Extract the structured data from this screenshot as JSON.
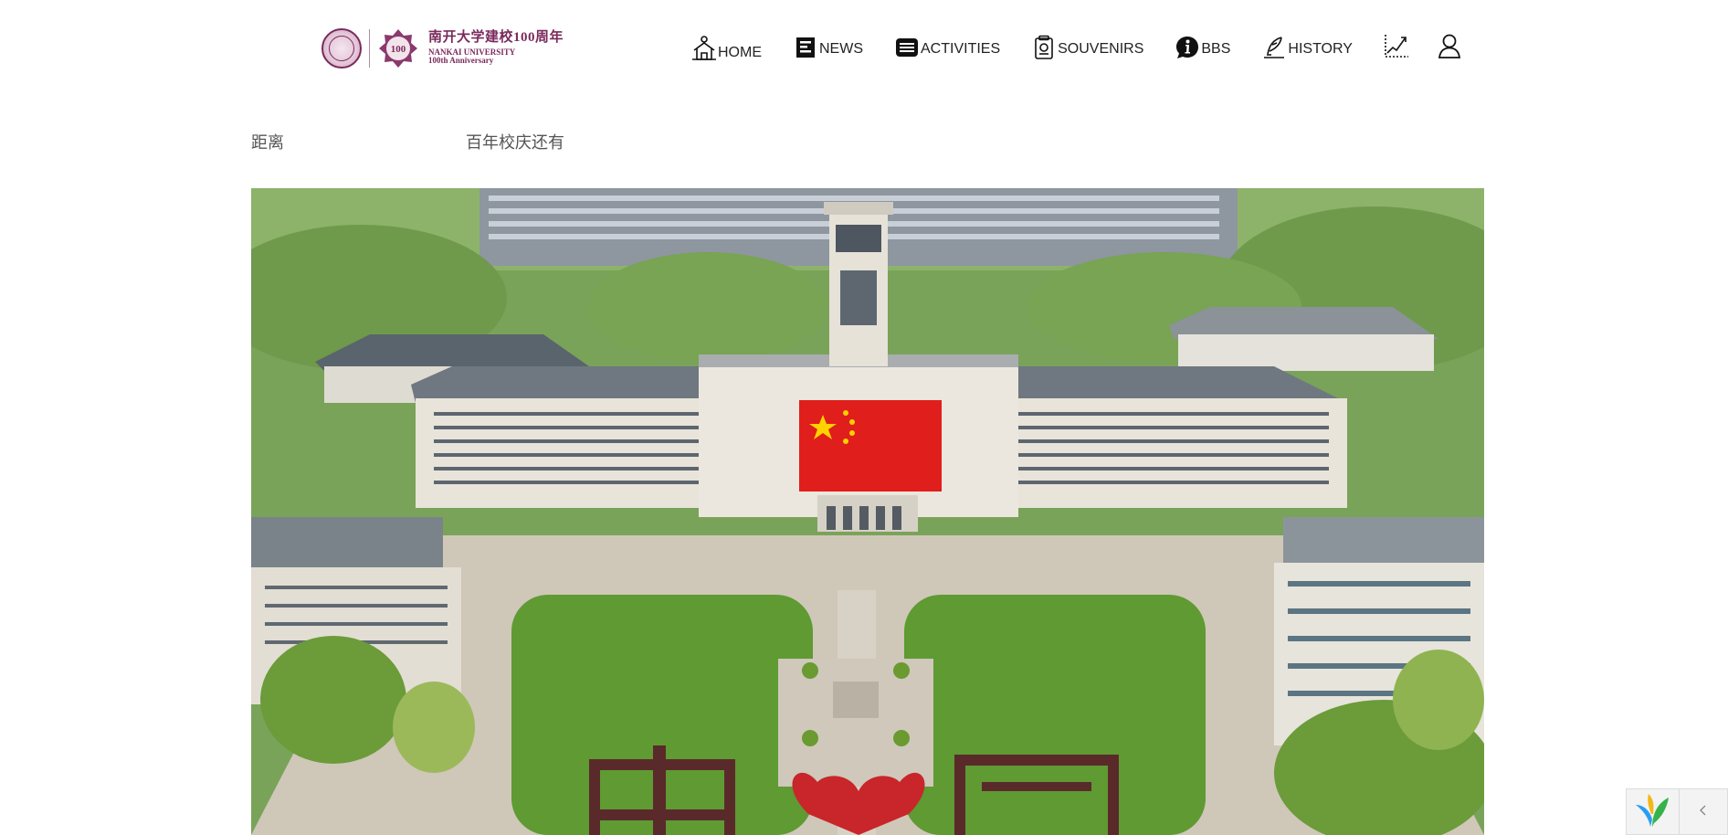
{
  "logo": {
    "badge_text": "100",
    "title_cn": "南开大学建校100周年",
    "title_en": "NANKAI UNIVERSITY",
    "subtitle_en": "100th Anniversary",
    "brand_color": "#7a2a5c"
  },
  "nav": {
    "items": [
      {
        "label": "HOME",
        "icon": "home-icon"
      },
      {
        "label": "NEWS",
        "icon": "news-icon"
      },
      {
        "label": "ACTIVITIES",
        "icon": "activities-icon"
      },
      {
        "label": "SOUVENIRS",
        "icon": "souvenirs-icon"
      },
      {
        "label": "BBS",
        "icon": "info-icon"
      },
      {
        "label": "HISTORY",
        "icon": "history-icon"
      }
    ],
    "extra_icons": [
      "chart-icon",
      "user-icon"
    ]
  },
  "countdown": {
    "prefix": "距离",
    "suffix": "百年校庆还有"
  },
  "hero": {
    "icon": "campus-photo"
  },
  "widget": {
    "icons": [
      "brand-leaf-icon",
      "chevron-left-icon"
    ],
    "accent_colors": [
      "#2a9df4",
      "#35b34a",
      "#f3b816"
    ]
  }
}
